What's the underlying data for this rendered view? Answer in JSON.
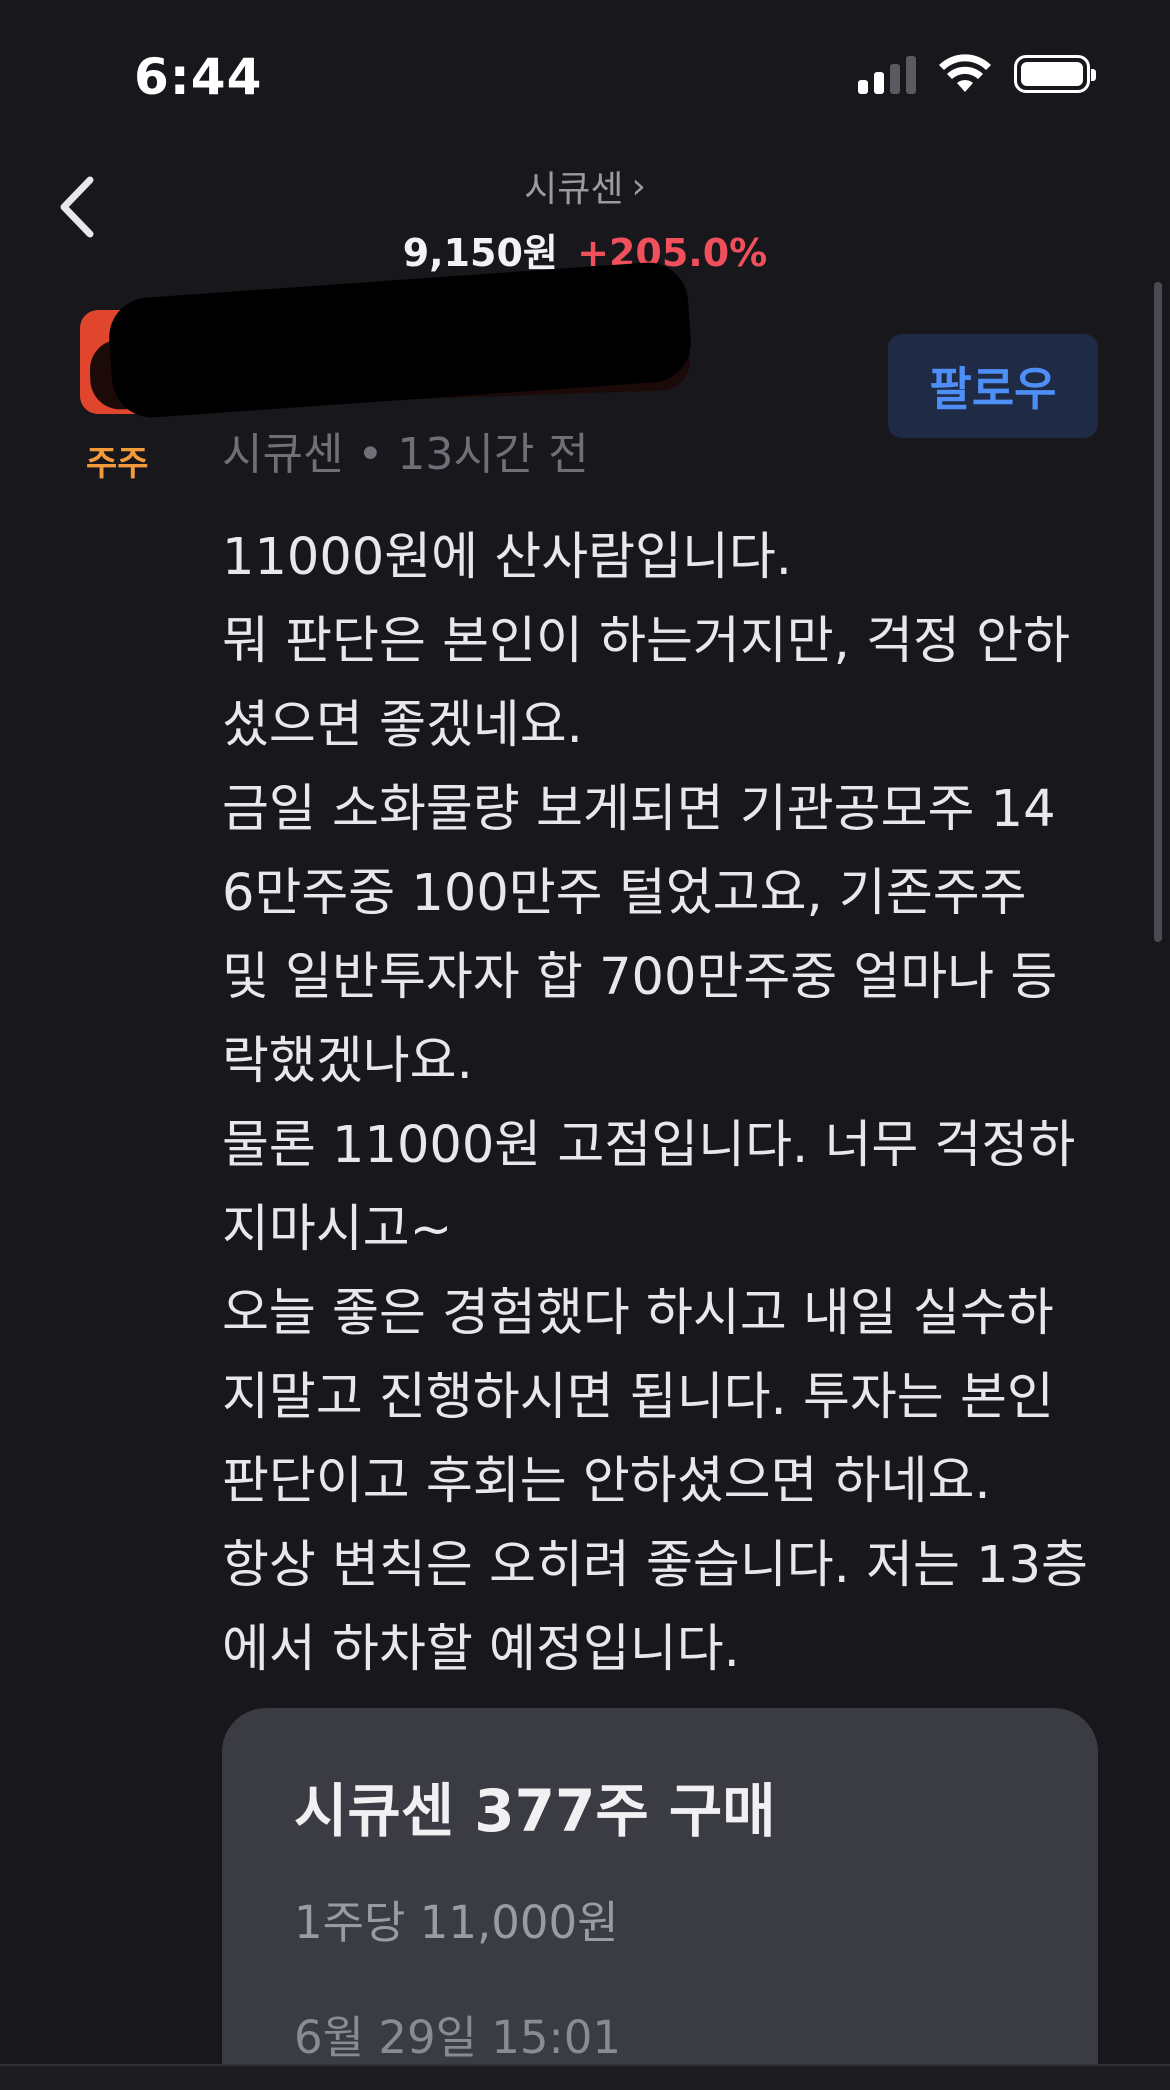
{
  "status_bar": {
    "time": "6:44",
    "signal_icon": "cellular-signal-icon",
    "wifi_icon": "wifi-icon",
    "battery_icon": "battery-icon"
  },
  "header": {
    "back_icon": "chevron-left-icon",
    "stock_name": "시큐센",
    "stock_chevron": "›",
    "price": "9,150원",
    "change": "+205.0%"
  },
  "author": {
    "badge": "주주",
    "meta": "시큐센 • 13시간 전",
    "follow_label": "팔로우"
  },
  "post": {
    "lines": [
      "11000원에 산사람입니다.",
      "뭐 판단은 본인이 하는거지만, 걱정 안하",
      "셨으면 좋겠네요.",
      "금일 소화물량 보게되면 기관공모주 14",
      "6만주중 100만주 털었고요, 기존주주",
      "및 일반투자자 합 700만주중  얼마나 등",
      "락했겠나요.",
      "물론 11000원 고점입니다. 너무 걱정하",
      "지마시고~",
      "오늘 좋은 경험했다 하시고 내일 실수하",
      "지말고 진행하시면 됩니다. 투자는 본인",
      "판단이고 후회는 안하셨으면 하네요.",
      "항상 변칙은 오히려 좋습니다. 저는 13층",
      "에서 하차할 예정입니다."
    ]
  },
  "trade": {
    "title": "시큐센 377주 구매",
    "price_per_share": "1주당 11,000원",
    "datetime": "6월 29일 15:01"
  },
  "colors": {
    "background": "#17171c",
    "positive_change": "#f0505c",
    "follow_text": "#4d8ef7",
    "follow_bg": "#1f2b44",
    "badge": "#f39a3a",
    "card_bg": "#3a3b43"
  }
}
